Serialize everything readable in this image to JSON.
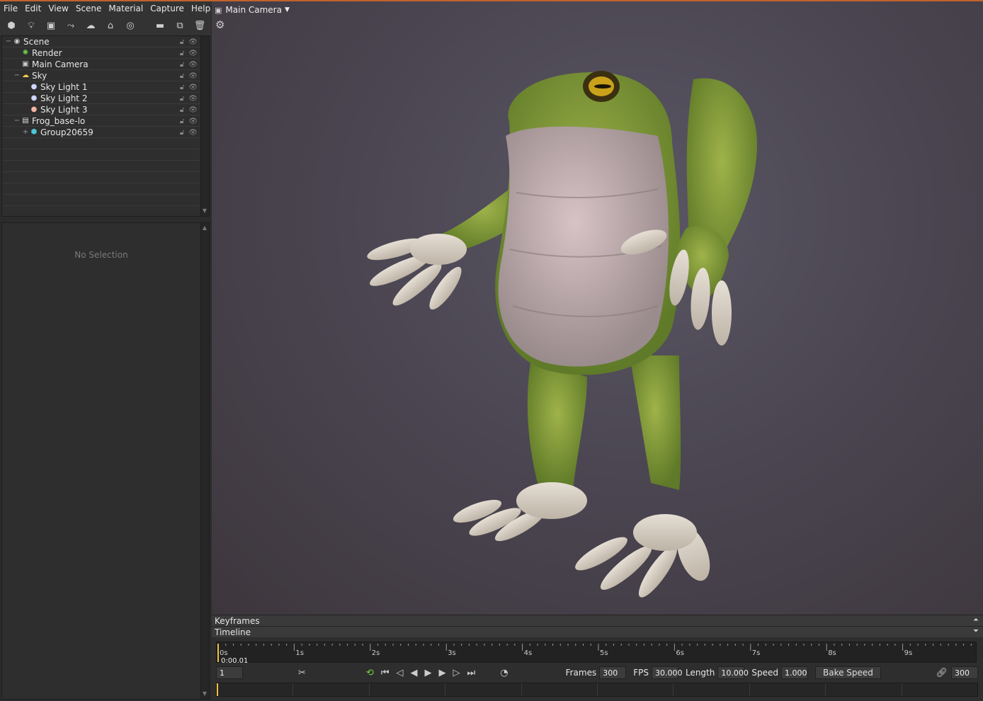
{
  "menu": [
    "File",
    "Edit",
    "View",
    "Scene",
    "Material",
    "Capture",
    "Help"
  ],
  "toolbar": {
    "left_icons": [
      "mesh-icon",
      "light-icon",
      "camera-icon",
      "turntable-icon",
      "sky-icon",
      "shadow-catcher-icon",
      "audio-icon"
    ],
    "right_icons": [
      "folder-icon",
      "duplicate-icon",
      "trash-icon"
    ]
  },
  "scene_tree": [
    {
      "label": "Scene",
      "icon": "scene-icon",
      "depth": 0,
      "expander": "−"
    },
    {
      "label": "Render",
      "icon": "render-icon",
      "depth": 1,
      "expander": ""
    },
    {
      "label": "Main Camera",
      "icon": "camera-icon",
      "depth": 1,
      "expander": ""
    },
    {
      "label": "Sky",
      "icon": "sky-icon",
      "depth": 1,
      "expander": "−"
    },
    {
      "label": "Sky Light 1",
      "icon": "light-bulb-icon",
      "depth": 2,
      "expander": ""
    },
    {
      "label": "Sky Light 2",
      "icon": "light-bulb-icon",
      "depth": 2,
      "expander": ""
    },
    {
      "label": "Sky Light 3",
      "icon": "light-bulb-warm-icon",
      "depth": 2,
      "expander": ""
    },
    {
      "label": "Frog_base-lo",
      "icon": "file-icon",
      "depth": 1,
      "expander": "−"
    },
    {
      "label": "Group20659",
      "icon": "mesh-group-icon",
      "depth": 2,
      "expander": "+"
    }
  ],
  "properties": {
    "empty_text": "No Selection"
  },
  "viewport": {
    "camera_label": "Main Camera"
  },
  "keyframes": {
    "label": "Keyframes"
  },
  "timeline": {
    "label": "Timeline",
    "ticks": [
      "0s",
      "1s",
      "2s",
      "3s",
      "4s",
      "5s",
      "6s",
      "7s",
      "8s",
      "9s"
    ],
    "current_time": "0:00.01",
    "current_frame": "1",
    "frames_label": "Frames",
    "frames": "300",
    "fps_label": "FPS",
    "fps": "30.000",
    "length_label": "Length",
    "length": "10.000",
    "speed_label": "Speed",
    "speed": "1.000",
    "bake_label": "Bake Speed",
    "end_frame": "300"
  }
}
